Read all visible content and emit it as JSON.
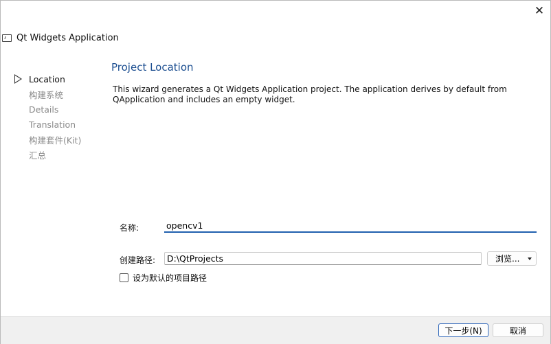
{
  "window": {
    "title": "Qt Widgets Application",
    "close_glyph": "✕"
  },
  "steps": [
    {
      "label": "Location",
      "current": true
    },
    {
      "label": "构建系统",
      "current": false
    },
    {
      "label": "Details",
      "current": false
    },
    {
      "label": "Translation",
      "current": false
    },
    {
      "label": "构建套件(Kit)",
      "current": false
    },
    {
      "label": "汇总",
      "current": false
    }
  ],
  "page": {
    "title": "Project Location",
    "description": "This wizard generates a Qt Widgets Application project. The application derives by default from QApplication and includes an empty widget."
  },
  "form": {
    "name_label": "名称:",
    "name_value": "opencv1",
    "path_label": "创建路径:",
    "path_value": "D:\\QtProjects",
    "browse_label": "浏览...",
    "default_checkbox_label": "设为默认的项目路径",
    "default_checked": false
  },
  "footer": {
    "next_label": "下一步(N)",
    "cancel_label": "取消"
  },
  "colors": {
    "title_blue": "#1d4f91",
    "focus_blue": "#1f5fae",
    "inactive_step": "#8a8a8a"
  }
}
